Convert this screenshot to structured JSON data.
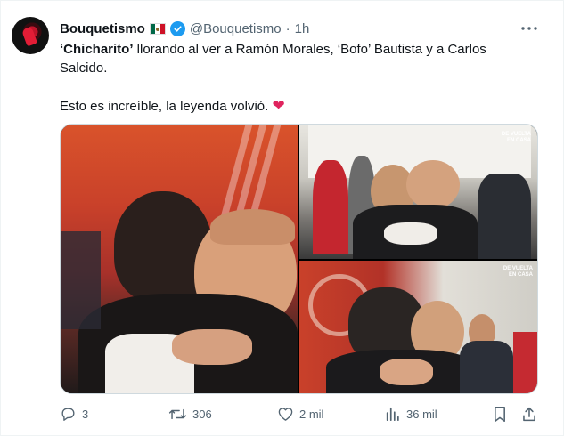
{
  "author": {
    "name": "Bouquetismo",
    "handle": "@Bouquetismo",
    "separator": "·",
    "time": "1h"
  },
  "tweet": {
    "bold_name": "‘Chicharito’",
    "line1_rest": " llorando al ver a Ramón Morales, ‘Bofo’ Bautista y a Carlos Salcido.",
    "line2": "Esto es increíble, la leyenda volvió.",
    "heart": "❤"
  },
  "media": {
    "watermark": "DE VUELTA EN CASA"
  },
  "metrics": {
    "replies": "3",
    "retweets": "306",
    "likes": "2 mil",
    "views": "36 mil"
  },
  "colors": {
    "accent": "#1d9bf0",
    "muted": "#536471",
    "heart": "#e0245e"
  },
  "icons": [
    "more-icon",
    "verified-icon",
    "reply-icon",
    "retweet-icon",
    "like-icon",
    "views-icon",
    "bookmark-icon",
    "share-icon"
  ]
}
